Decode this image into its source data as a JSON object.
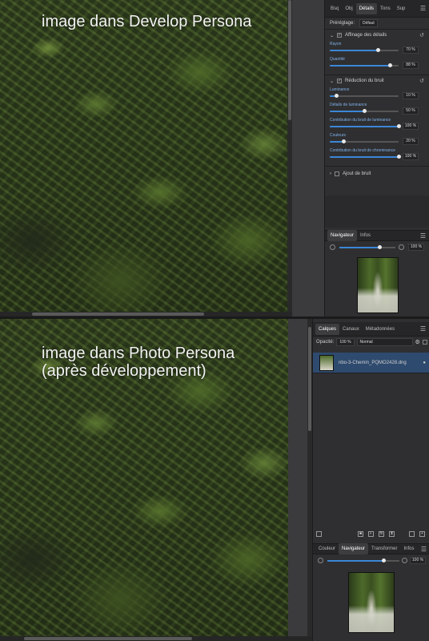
{
  "top": {
    "caption": "image dans Develop Persona",
    "tabs": [
      "Bsq",
      "Obj",
      "Détails",
      "Tons",
      "Sup"
    ],
    "active_tab": "Détails",
    "preset": {
      "label": "Préréglage:",
      "value": "Défaut"
    },
    "detail_section": {
      "title": "Affinage des détails",
      "params": [
        {
          "label": "Rayon",
          "value": "70 %",
          "pct": 0.7
        },
        {
          "label": "Quantité",
          "value": "88 %",
          "pct": 0.88
        }
      ]
    },
    "noise_section": {
      "title": "Réduction du bruit",
      "params": [
        {
          "label": "Luminance",
          "value": "10 %",
          "pct": 0.1
        },
        {
          "label": "Détails de luminance",
          "value": "50 %",
          "pct": 0.5
        },
        {
          "label": "Contribution du bruit de luminance",
          "value": "100 %",
          "pct": 1.0
        },
        {
          "label": "Couleurs",
          "value": "20 %",
          "pct": 0.2
        },
        {
          "label": "Contribution du bruit de chrominance",
          "value": "100 %",
          "pct": 1.0
        }
      ]
    },
    "add_noise": "Ajout de bruit",
    "nav_tabs": [
      "Navigateur",
      "Infos"
    ],
    "zoom": {
      "value": "100 %",
      "pct": 0.72
    }
  },
  "bottom": {
    "caption": "image dans Photo Persona\n(après développement)",
    "tabs": [
      "Calques",
      "Canaux",
      "Métadonnées"
    ],
    "active_tab": "Calques",
    "opacity": {
      "label": "Opacité:",
      "value": "100 %"
    },
    "blend": "Normal",
    "layer_name": "nbo-3-Chemin_PQMO2428.dng",
    "nav_tabs": [
      "Couleur",
      "Navigateur",
      "Transformer",
      "Infos"
    ],
    "nav_active": "Navigateur",
    "zoom": {
      "value": "100 %",
      "pct": 0.78
    }
  },
  "colors": {
    "accent": "#3c87d6",
    "selection": "#2e4a6e",
    "panel": "#2f2f31"
  }
}
